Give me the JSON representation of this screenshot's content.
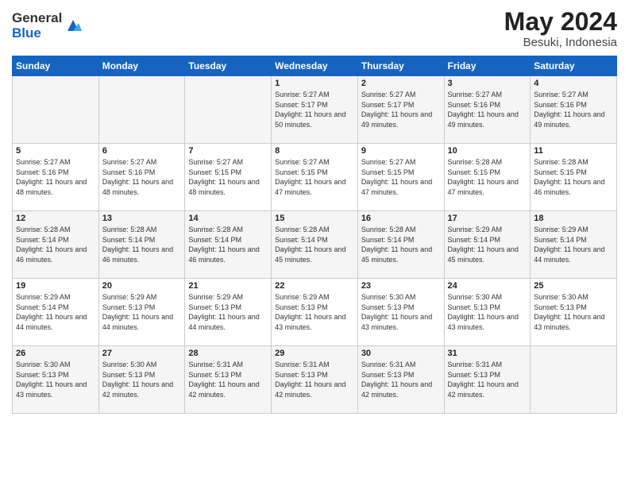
{
  "logo": {
    "general": "General",
    "blue": "Blue"
  },
  "title": {
    "month_year": "May 2024",
    "location": "Besuki, Indonesia"
  },
  "headers": [
    "Sunday",
    "Monday",
    "Tuesday",
    "Wednesday",
    "Thursday",
    "Friday",
    "Saturday"
  ],
  "weeks": [
    [
      {
        "day": "",
        "info": ""
      },
      {
        "day": "",
        "info": ""
      },
      {
        "day": "",
        "info": ""
      },
      {
        "day": "1",
        "info": "Sunrise: 5:27 AM\nSunset: 5:17 PM\nDaylight: 11 hours\nand 50 minutes."
      },
      {
        "day": "2",
        "info": "Sunrise: 5:27 AM\nSunset: 5:17 PM\nDaylight: 11 hours\nand 49 minutes."
      },
      {
        "day": "3",
        "info": "Sunrise: 5:27 AM\nSunset: 5:16 PM\nDaylight: 11 hours\nand 49 minutes."
      },
      {
        "day": "4",
        "info": "Sunrise: 5:27 AM\nSunset: 5:16 PM\nDaylight: 11 hours\nand 49 minutes."
      }
    ],
    [
      {
        "day": "5",
        "info": "Sunrise: 5:27 AM\nSunset: 5:16 PM\nDaylight: 11 hours\nand 48 minutes."
      },
      {
        "day": "6",
        "info": "Sunrise: 5:27 AM\nSunset: 5:16 PM\nDaylight: 11 hours\nand 48 minutes."
      },
      {
        "day": "7",
        "info": "Sunrise: 5:27 AM\nSunset: 5:15 PM\nDaylight: 11 hours\nand 48 minutes."
      },
      {
        "day": "8",
        "info": "Sunrise: 5:27 AM\nSunset: 5:15 PM\nDaylight: 11 hours\nand 47 minutes."
      },
      {
        "day": "9",
        "info": "Sunrise: 5:27 AM\nSunset: 5:15 PM\nDaylight: 11 hours\nand 47 minutes."
      },
      {
        "day": "10",
        "info": "Sunrise: 5:28 AM\nSunset: 5:15 PM\nDaylight: 11 hours\nand 47 minutes."
      },
      {
        "day": "11",
        "info": "Sunrise: 5:28 AM\nSunset: 5:15 PM\nDaylight: 11 hours\nand 46 minutes."
      }
    ],
    [
      {
        "day": "12",
        "info": "Sunrise: 5:28 AM\nSunset: 5:14 PM\nDaylight: 11 hours\nand 46 minutes."
      },
      {
        "day": "13",
        "info": "Sunrise: 5:28 AM\nSunset: 5:14 PM\nDaylight: 11 hours\nand 46 minutes."
      },
      {
        "day": "14",
        "info": "Sunrise: 5:28 AM\nSunset: 5:14 PM\nDaylight: 11 hours\nand 46 minutes."
      },
      {
        "day": "15",
        "info": "Sunrise: 5:28 AM\nSunset: 5:14 PM\nDaylight: 11 hours\nand 45 minutes."
      },
      {
        "day": "16",
        "info": "Sunrise: 5:28 AM\nSunset: 5:14 PM\nDaylight: 11 hours\nand 45 minutes."
      },
      {
        "day": "17",
        "info": "Sunrise: 5:29 AM\nSunset: 5:14 PM\nDaylight: 11 hours\nand 45 minutes."
      },
      {
        "day": "18",
        "info": "Sunrise: 5:29 AM\nSunset: 5:14 PM\nDaylight: 11 hours\nand 44 minutes."
      }
    ],
    [
      {
        "day": "19",
        "info": "Sunrise: 5:29 AM\nSunset: 5:14 PM\nDaylight: 11 hours\nand 44 minutes."
      },
      {
        "day": "20",
        "info": "Sunrise: 5:29 AM\nSunset: 5:13 PM\nDaylight: 11 hours\nand 44 minutes."
      },
      {
        "day": "21",
        "info": "Sunrise: 5:29 AM\nSunset: 5:13 PM\nDaylight: 11 hours\nand 44 minutes."
      },
      {
        "day": "22",
        "info": "Sunrise: 5:29 AM\nSunset: 5:13 PM\nDaylight: 11 hours\nand 43 minutes."
      },
      {
        "day": "23",
        "info": "Sunrise: 5:30 AM\nSunset: 5:13 PM\nDaylight: 11 hours\nand 43 minutes."
      },
      {
        "day": "24",
        "info": "Sunrise: 5:30 AM\nSunset: 5:13 PM\nDaylight: 11 hours\nand 43 minutes."
      },
      {
        "day": "25",
        "info": "Sunrise: 5:30 AM\nSunset: 5:13 PM\nDaylight: 11 hours\nand 43 minutes."
      }
    ],
    [
      {
        "day": "26",
        "info": "Sunrise: 5:30 AM\nSunset: 5:13 PM\nDaylight: 11 hours\nand 43 minutes."
      },
      {
        "day": "27",
        "info": "Sunrise: 5:30 AM\nSunset: 5:13 PM\nDaylight: 11 hours\nand 42 minutes."
      },
      {
        "day": "28",
        "info": "Sunrise: 5:31 AM\nSunset: 5:13 PM\nDaylight: 11 hours\nand 42 minutes."
      },
      {
        "day": "29",
        "info": "Sunrise: 5:31 AM\nSunset: 5:13 PM\nDaylight: 11 hours\nand 42 minutes."
      },
      {
        "day": "30",
        "info": "Sunrise: 5:31 AM\nSunset: 5:13 PM\nDaylight: 11 hours\nand 42 minutes."
      },
      {
        "day": "31",
        "info": "Sunrise: 5:31 AM\nSunset: 5:13 PM\nDaylight: 11 hours\nand 42 minutes."
      },
      {
        "day": "",
        "info": ""
      }
    ]
  ]
}
